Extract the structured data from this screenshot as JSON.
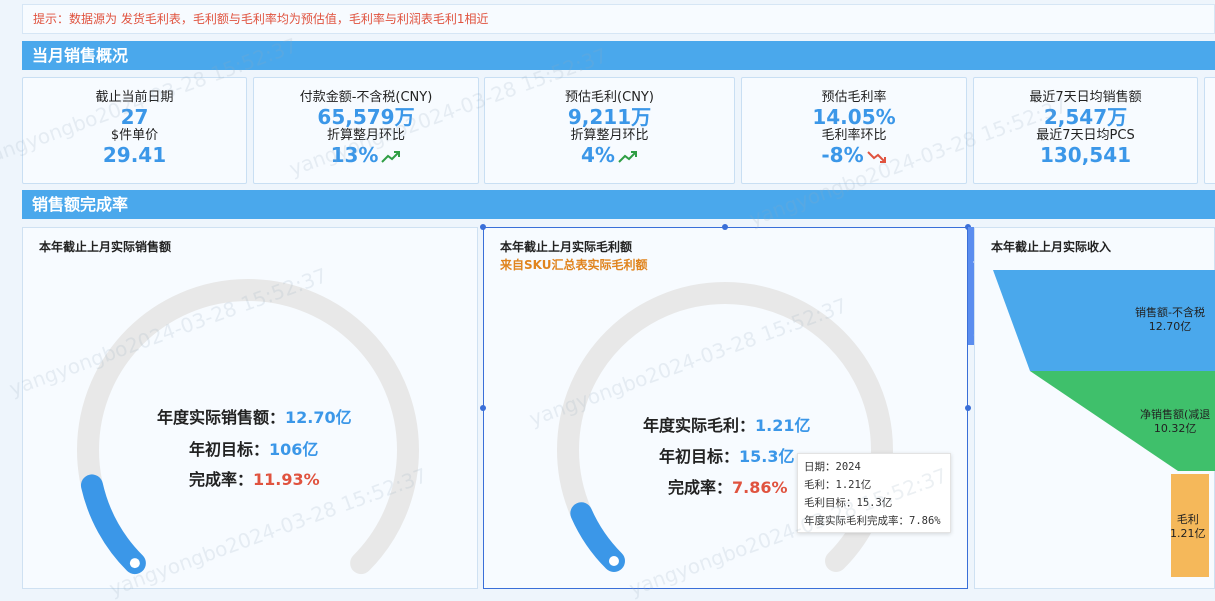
{
  "notice": "提示：数据源为 发货毛利表，毛利额与毛利率均为预估值，毛利率与利润表毛利1相近",
  "sections": {
    "monthly": "当月销售概况",
    "completion": "销售额完成率"
  },
  "kpis": [
    {
      "label": "截止当前日期",
      "value": "27",
      "sub_label": "$件单价",
      "sub_value": "29.41"
    },
    {
      "label": "付款金额-不含税(CNY)",
      "value": "65,579万",
      "sub_label": "折算整月环比",
      "sub_value": "13%",
      "trend": "up"
    },
    {
      "label": "预估毛利(CNY)",
      "value": "9,211万",
      "sub_label": "折算整月环比",
      "sub_value": "4%",
      "trend": "up"
    },
    {
      "label": "预估毛利率",
      "value": "14.05%",
      "sub_label": "毛利率环比",
      "sub_value": "-8%",
      "trend": "down"
    },
    {
      "label": "最近7天日均销售额",
      "value": "2,547万",
      "sub_label": "最近7天日均PCS",
      "sub_value": "130,541"
    }
  ],
  "panel1": {
    "title": "本年截止上月实际销售额",
    "actual_label": "年度实际销售额：",
    "actual_value": "12.70亿",
    "target_label": "年初目标：",
    "target_value": "106亿",
    "rate_label": "完成率：",
    "rate_value": "11.93%",
    "progress": 0.1193
  },
  "panel2": {
    "title": "本年截止上月实际毛利额",
    "subtitle": "来自SKU汇总表实际毛利额",
    "actual_label": "年度实际毛利：",
    "actual_value": "1.21亿",
    "target_label": "年初目标：",
    "target_value": "15.3亿",
    "rate_label": "完成率：",
    "rate_value": "7.86%",
    "progress": 0.0786
  },
  "tooltip": {
    "line1": "日期：2024",
    "line2": "毛利：1.21亿",
    "line3": "毛利目标：15.3亿",
    "line4": "年度实际毛利完成率：7.86%"
  },
  "panel3": {
    "title": "本年截止上月实际收入",
    "stages": [
      {
        "name": "销售额-不含税",
        "value": "12.70亿"
      },
      {
        "name": "净销售额(减退",
        "value": "10.32亿"
      },
      {
        "name": "毛利",
        "value": "1.21亿"
      }
    ]
  },
  "toolbar": [
    "edit-icon",
    "undo-icon",
    "copy-icon",
    "comment-icon",
    "more-icon"
  ],
  "watermark": "yangyongbo2024-03-28 15:52:37",
  "colors": {
    "accent": "#4aa8ec",
    "value_blue": "#3b97e8",
    "rate_red": "#e0533f",
    "gauge_track": "#e8e8e8",
    "funnel_blue": "#4aa8ec",
    "funnel_green": "#3fc06b",
    "funnel_orange": "#f5b85a"
  }
}
